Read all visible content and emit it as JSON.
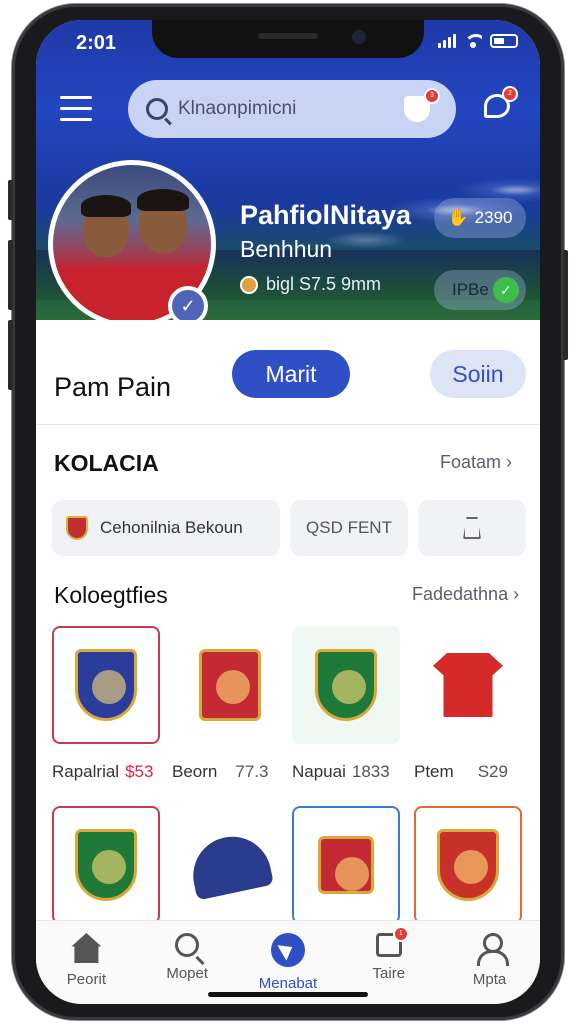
{
  "status_bar": {
    "time": "2:01"
  },
  "header": {
    "search_placeholder": "Klnaonpimicni",
    "cart_badge": "3",
    "chat_badge": "2"
  },
  "profile": {
    "name": "PahfiolNitaya",
    "subtitle": "Benhhun",
    "meta": "bigl S7.5 9mm",
    "stat_top": "2390",
    "stat_bottom": "IPBe"
  },
  "actions": {
    "title": "Pam Pain",
    "primary_label": "Marit",
    "secondary_label": "Soiin"
  },
  "collection": {
    "heading": "KOLACIA",
    "link": "Foatam",
    "chips": [
      {
        "label": "Cehonilnia Bekoun"
      },
      {
        "label": "QSD FENT"
      },
      {
        "label": ""
      }
    ]
  },
  "categories": {
    "heading": "Koloegtfies",
    "link": "Fadedathna",
    "items": [
      {
        "name": "Rapalrial",
        "price": "$53",
        "price_color": "#d22a3a"
      },
      {
        "name": "Beorn",
        "price": "77.3",
        "price_color": "#555555"
      },
      {
        "name": "Napuai",
        "price": "1833",
        "price_color": "#555555"
      },
      {
        "name": "Ptem",
        "price": "S29",
        "price_color": "#555555"
      }
    ]
  },
  "bottom_nav": [
    {
      "label": "Peorit",
      "icon": "home-icon"
    },
    {
      "label": "Mopet",
      "icon": "search-icon"
    },
    {
      "label": "Menabat",
      "icon": "compass-icon",
      "active": true
    },
    {
      "label": "Taire",
      "icon": "cart-icon",
      "badge": "1"
    },
    {
      "label": "Mpta",
      "icon": "user-icon"
    }
  ],
  "colors": {
    "accent": "#2f4fc4",
    "header_blue": "#2346c0",
    "badge_red": "#e23b3b"
  }
}
